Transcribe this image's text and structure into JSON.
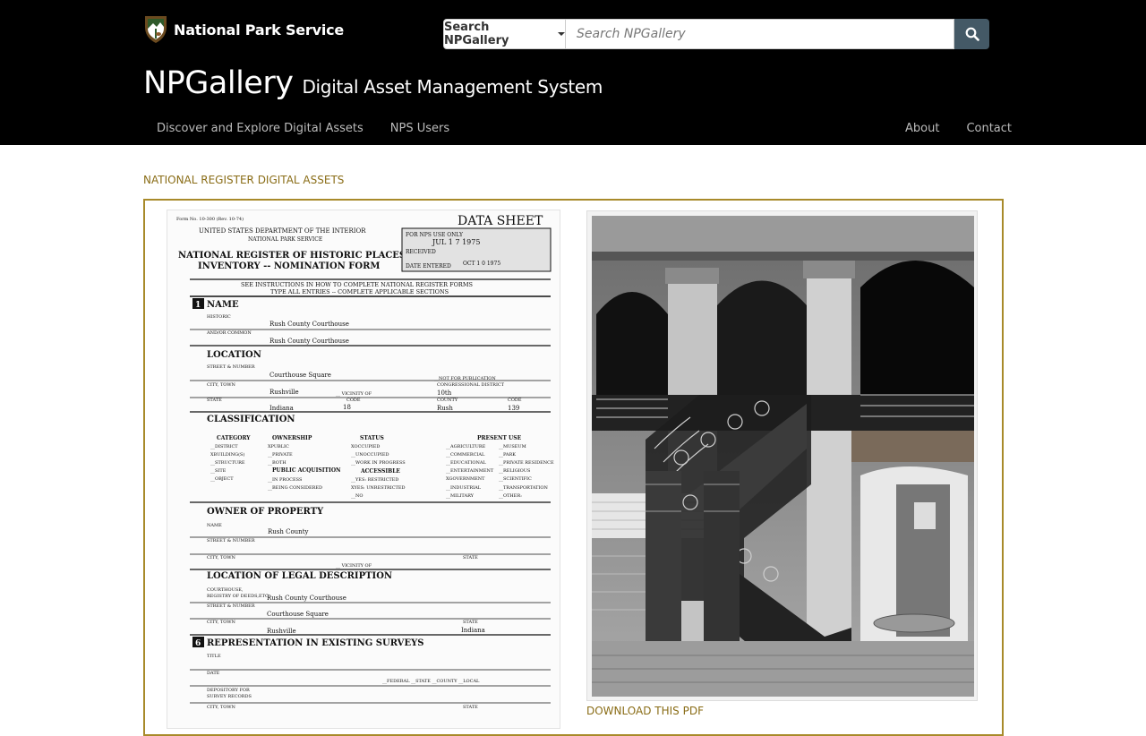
{
  "header": {
    "agency_name": "National Park Service",
    "search": {
      "dropdown_label": "Search NPGallery",
      "placeholder": "Search NPGallery",
      "button_icon": "search-icon"
    },
    "brand_main": "NPGallery",
    "brand_sub": "Digital Asset Management System",
    "nav_left": [
      "Discover and Explore Digital Assets",
      "NPS Users"
    ],
    "nav_right": [
      "About",
      "Contact"
    ]
  },
  "main": {
    "section_label": "NATIONAL REGISTER DIGITAL ASSETS",
    "document": {
      "form_no": "Form No. 10-300 (Rev. 10-74)",
      "data_sheet": "DATA SHEET",
      "department": "UNITED STATES DEPARTMENT OF THE INTERIOR",
      "service": "NATIONAL PARK SERVICE",
      "title_line1": "NATIONAL REGISTER OF HISTORIC PLACES",
      "title_line2": "INVENTORY -- NOMINATION FORM",
      "nps_use_only": "FOR NPS USE ONLY",
      "received_date": "JUL 1 7 1975",
      "received_label": "RECEIVED",
      "entered_label": "DATE ENTERED",
      "entered_date": "OCT 1 0 1975",
      "instructions_line1": "SEE INSTRUCTIONS IN HOW TO COMPLETE NATIONAL REGISTER FORMS",
      "instructions_line2": "TYPE ALL ENTRIES -- COMPLETE APPLICABLE SECTIONS",
      "sec1_num": "1",
      "sec1_title": "NAME",
      "historic_label": "HISTORIC",
      "historic_value": "Rush County Courthouse",
      "common_label": "AND/OR COMMON",
      "common_value": "Rush County Courthouse",
      "sec2_title": "LOCATION",
      "street_label": "STREET & NUMBER",
      "street_value": "Courthouse Square",
      "not_for_pub": "__NOT FOR PUBLICATION",
      "city_label": "CITY, TOWN",
      "city_value": "Rushville",
      "vicinity_label": "__ VICINITY OF",
      "cong_district_label": "CONGRESSIONAL DISTRICT",
      "cong_district_value": "10th",
      "state_label": "STATE",
      "state_value": "Indiana",
      "code_label": "CODE",
      "code_value": "18",
      "county_label": "COUNTY",
      "county_value": "Rush",
      "county_code_label": "CODE",
      "county_code_value": "139",
      "sec3_title": "CLASSIFICATION",
      "category_head": "CATEGORY",
      "ownership_head": "OWNERSHIP",
      "status_head": "STATUS",
      "present_use_head": "PRESENT USE",
      "category_items": [
        "__DISTRICT",
        "XBUILDING(S)",
        "__STRUCTURE",
        "__SITE",
        "__OBJECT"
      ],
      "ownership_items": [
        "XPUBLIC",
        "__PRIVATE",
        "__BOTH"
      ],
      "public_acq_head": "PUBLIC ACQUISITION",
      "public_acq_items": [
        "__IN PROCESS",
        "__BEING CONSIDERED"
      ],
      "status_items": [
        "XOCCUPIED",
        "__UNOCCUPIED",
        "__WORK IN PROGRESS"
      ],
      "accessible_head": "ACCESSIBLE",
      "accessible_items": [
        "__YES: RESTRICTED",
        "XYES: UNRESTRICTED",
        "__NO"
      ],
      "use_col1": [
        "__AGRICULTURE",
        "__COMMERCIAL",
        "__EDUCATIONAL",
        "__ENTERTAINMENT",
        "XGOVERNMENT",
        "__INDUSTRIAL",
        "__MILITARY"
      ],
      "use_col2": [
        "__MUSEUM",
        "__PARK",
        "__PRIVATE RESIDENCE",
        "__RELIGIOUS",
        "__SCIENTIFIC",
        "__TRANSPORTATION",
        "__OTHER:"
      ],
      "sec4_title": "OWNER OF PROPERTY",
      "owner_name_label": "NAME",
      "owner_name_value": "Rush County",
      "owner_street_label": "STREET & NUMBER",
      "owner_city_label": "CITY, TOWN",
      "owner_vicinity_label": "__ VICINITY OF",
      "owner_state_label": "STATE",
      "sec5_title": "LOCATION OF LEGAL DESCRIPTION",
      "courthouse_label1": "COURTHOUSE,",
      "courthouse_label2": "REGISTRY OF DEEDS,ETC.",
      "courthouse_value": "Rush County Courthouse",
      "legal_street_label": "STREET & NUMBER",
      "legal_street_value": "Courthouse Square",
      "legal_city_label": "CITY, TOWN",
      "legal_city_value": "Rushville",
      "legal_state_label": "STATE",
      "legal_state_value": "Indiana",
      "sec6_num": "6",
      "sec6_title": "REPRESENTATION IN EXISTING SURVEYS",
      "title_label": "TITLE",
      "date_label": "DATE",
      "survey_levels": "__FEDERAL  __STATE  __COUNTY  __LOCAL",
      "depository_label1": "DEPOSITORY FOR",
      "depository_label2": "SURVEY RECORDS",
      "survey_city_label": "CITY, TOWN",
      "survey_state_label": "STATE"
    },
    "download_label": "DOWNLOAD THIS PDF"
  },
  "colors": {
    "header_bg": "#000000",
    "accent_gold": "#8a6d17",
    "panel_border": "#a88a2a",
    "search_button": "#445966"
  }
}
